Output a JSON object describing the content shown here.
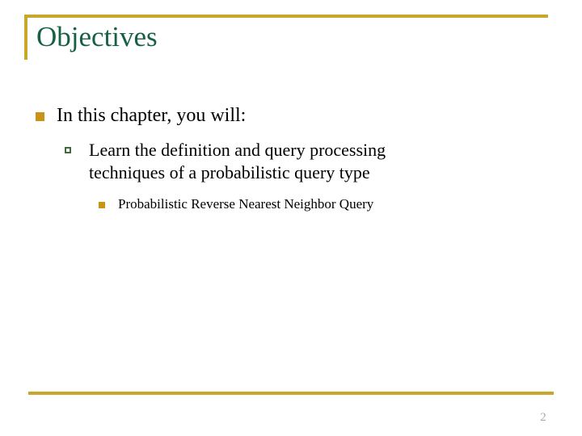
{
  "slide": {
    "title": "Objectives",
    "title_color": "#166044",
    "accent_color": "#c8a72b",
    "background_color": "#ffffff",
    "page_number": "2"
  },
  "bullets": {
    "level1": {
      "marker": "filled-square-gold",
      "text": "In this chapter, you will:"
    },
    "level2": {
      "marker": "hollow-square-green",
      "line1": "Learn the definition and query processing",
      "line2": "techniques of a probabilistic query type",
      "text": "Learn the definition and query processing techniques of a probabilistic query type"
    },
    "level3": {
      "marker": "filled-square-gold-small",
      "text": "Probabilistic Reverse Nearest Neighbor Query"
    }
  }
}
